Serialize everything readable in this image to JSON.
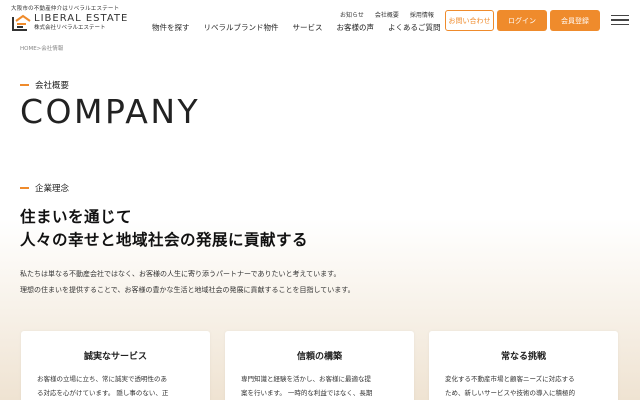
{
  "header": {
    "tagline": "大阪市の不動産仲介はリベラルエステート",
    "logo": {
      "name": "LIBERAL ESTATE",
      "sub": "株式会社リベラルエステート"
    },
    "sub_nav": [
      "お知らせ",
      "会社概要",
      "採用情報"
    ],
    "main_nav": [
      "物件を探す",
      "リベラルブランド物件",
      "サービス",
      "お客様の声",
      "よくあるご質問"
    ],
    "contact_label": "お問い合わせ",
    "login_label": "ログイン",
    "register_label": "会員登録",
    "menu_icon": "hamburger-icon",
    "accent_color": "#ef8b2c"
  },
  "breadcrumb": "HOME>会社情報",
  "overview": {
    "label": "会社概要",
    "title": "COMPANY"
  },
  "philosophy": {
    "label": "企業理念",
    "headline_line1": "住まいを通じて",
    "headline_line2": "人々の幸せと地域社会の発展に貢献する",
    "intro_line1": "私たちは単なる不動産会社ではなく、お客様の人生に寄り添うパートナーでありたいと考えています。",
    "intro_line2": "理想の住まいを提供することで、お客様の豊かな生活と地域社会の発展に貢献することを目指しています。"
  },
  "cards": [
    {
      "title": "誠実なサービス",
      "line1": "お客様の立場に立ち、常に誠実で透明性のあ",
      "line2": "る対応を心がけています。 隠し事のない、正"
    },
    {
      "title": "信頼の構築",
      "line1": "専門知識と経験を活かし、お客様に最適な提",
      "line2": "案を行います。 一時的な利益ではなく、長期"
    },
    {
      "title": "常なる挑戦",
      "line1": "変化する不動産市場と顧客ニーズに対応する",
      "line2": "ため、新しいサービスや技術の導入に積極的"
    }
  ]
}
